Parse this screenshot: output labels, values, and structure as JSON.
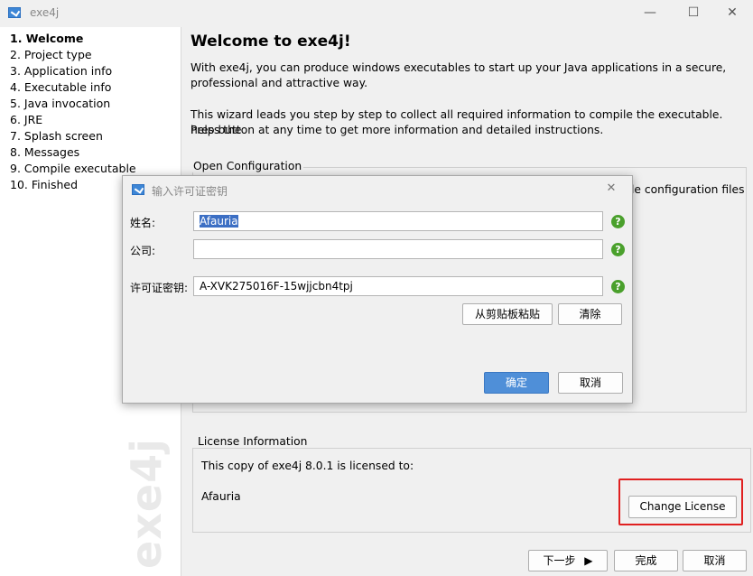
{
  "window": {
    "title": "exe4j",
    "minimize": "—",
    "maximize": "☐",
    "close": "✕"
  },
  "steps": [
    "1. Welcome",
    "2. Project type",
    "3. Application info",
    "4. Executable info",
    "5. Java invocation",
    "6. JRE",
    "7. Splash screen",
    "8. Messages",
    "9. Compile executable",
    "10. Finished"
  ],
  "watermark": "exe4j",
  "main": {
    "title": "Welcome to exe4j!",
    "para1_line1": "With exe4j, you can produce windows executables to start up your Java applications in a secure,",
    "para1_line2": "professional and attractive way.",
    "para2_line1": "This wizard leads you step by step to collect all required information to compile the executable. Press the",
    "para2_line2": "help button at any time to get more information and detailed instructions.",
    "open_config_label": "Open Configuration",
    "open_config_partial": "le configuration files",
    "license_group": "License Information",
    "license_text": "This copy of exe4j 8.0.1 is licensed to:",
    "licensee": "Afauria",
    "change_license": "Change License"
  },
  "footer": {
    "next": "下一步",
    "next_arrow": "▶",
    "finish": "完成",
    "cancel": "取消"
  },
  "dialog": {
    "title": "输入许可证密钥",
    "close": "✕",
    "name_label": "姓名:",
    "name_value": "Afauria",
    "company_label": "公司:",
    "company_value": "",
    "key_label": "许可证密钥:",
    "key_value": "A-XVK275016F-15wjjcbn4tpj",
    "help_glyph": "?",
    "paste_button": "从剪贴板粘贴",
    "clear_button": "清除",
    "ok_button": "确定",
    "cancel_button": "取消"
  }
}
